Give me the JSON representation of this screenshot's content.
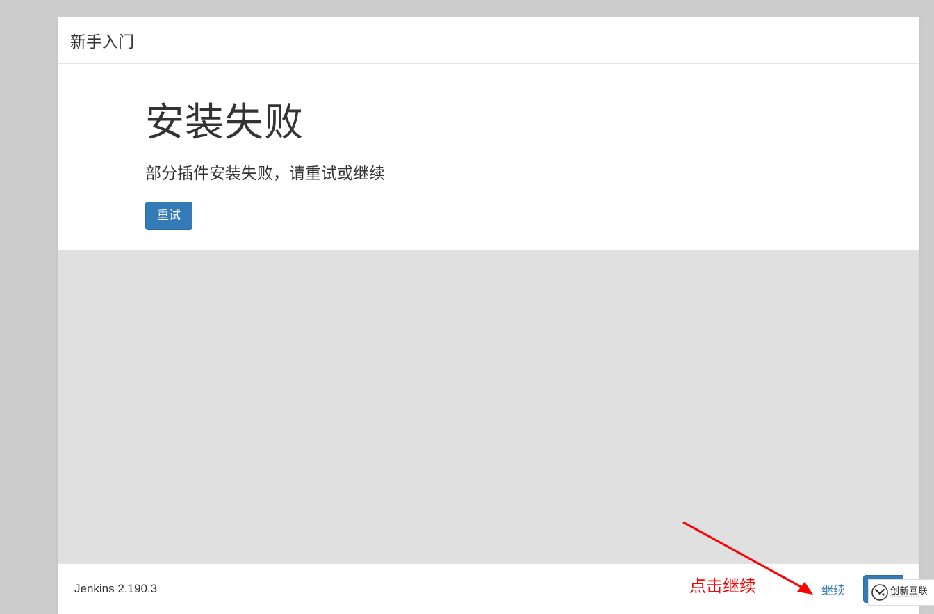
{
  "dialog": {
    "title": "新手入门",
    "heading": "安装失败",
    "subtitle": "部分插件安装失败，请重试或继续",
    "retry_label": "重试"
  },
  "footer": {
    "version": "Jenkins 2.190.3",
    "continue_label": "继续"
  },
  "annotation": {
    "text": "点击继续"
  },
  "watermark": {
    "main": "创新互联",
    "sub": "CHUANG XINTALIAN"
  }
}
